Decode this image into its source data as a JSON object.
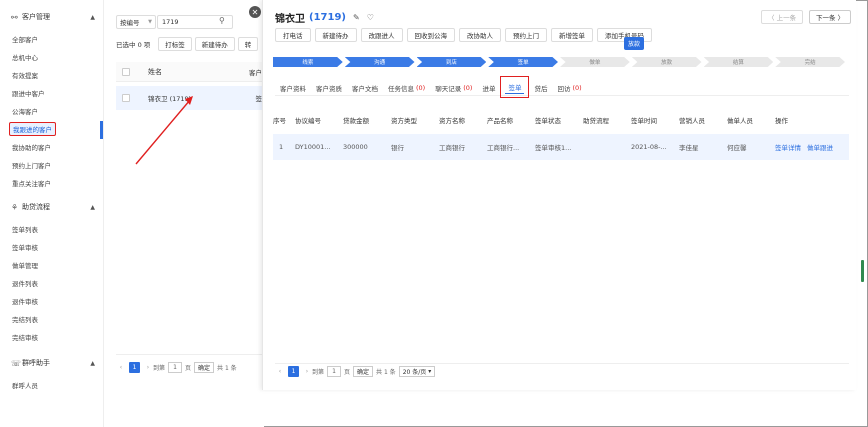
{
  "sidebar": {
    "groups": [
      {
        "label": "客户管理",
        "icon": "user-icon",
        "items": [
          "全部客户",
          "总机中心",
          "有效提案",
          "跟进中客户",
          "公海客户",
          "我跟进的客户",
          "我协助的客户",
          "预约上门客户",
          "重点关注客户"
        ]
      },
      {
        "label": "助贷流程",
        "icon": "flow-icon",
        "items": [
          "签单列表",
          "签单审核",
          "做单管理",
          "退件列表",
          "退件审核",
          "完结列表",
          "完结审核"
        ]
      },
      {
        "label": "群呼助手",
        "icon": "phone-icon",
        "items": [
          "群呼人员"
        ]
      }
    ],
    "active_item": "我跟进的客户"
  },
  "list_panel": {
    "search_type": "按编号",
    "search_value": "1719",
    "selected_count": "已选中 0 项",
    "toolbar_buttons": [
      "打标签",
      "新建待办",
      "转"
    ],
    "column_name": "姓名",
    "column_customer": "客户",
    "rows": [
      {
        "name": "锦衣卫 (1719)",
        "col2": "签"
      }
    ],
    "pagination": {
      "page": "1",
      "goto_label": "到第",
      "goto_value": "1",
      "page_unit": "页",
      "confirm": "确定",
      "total": "共 1 条"
    }
  },
  "detail": {
    "title": "锦衣卫",
    "id": "(1719)",
    "prev_label": "〈 上一条",
    "next_label": "下一条 〉",
    "actions": [
      "打电话",
      "新建待办",
      "改跟进人",
      "回收到公海",
      "改协助人",
      "预约上门",
      "新增签单",
      "添加手机号码"
    ],
    "tooltip": "放款",
    "steps": [
      {
        "label": "线索",
        "done": true
      },
      {
        "label": "沟通",
        "done": true
      },
      {
        "label": "到店",
        "done": true
      },
      {
        "label": "签单",
        "done": true
      },
      {
        "label": "做单",
        "done": false
      },
      {
        "label": "放款",
        "done": false
      },
      {
        "label": "结算",
        "done": false
      },
      {
        "label": "完结",
        "done": false
      }
    ],
    "tabs": [
      {
        "label": "客户资料",
        "count": ""
      },
      {
        "label": "客户资质",
        "count": ""
      },
      {
        "label": "客户文档",
        "count": ""
      },
      {
        "label": "任务信息",
        "count": "(0)"
      },
      {
        "label": "聊天记录",
        "count": "(0)"
      },
      {
        "label": "进单",
        "count": ""
      },
      {
        "label": "签单",
        "count": ""
      },
      {
        "label": "贷后",
        "count": ""
      },
      {
        "label": "回访",
        "count": "(0)"
      }
    ],
    "active_tab": "签单",
    "table": {
      "headers": [
        "序号",
        "协议编号",
        "贷款金额",
        "资方类型",
        "资方名称",
        "产品名称",
        "签单状态",
        "助贷流程",
        "签单时间",
        "营销人员",
        "做单人员",
        "操作"
      ],
      "rows": [
        {
          "cells": [
            "1",
            "DY10001...",
            "300000",
            "银行",
            "工商银行",
            "工商银行...",
            "签单审核1...",
            "",
            "2021-08-...",
            "李佳星",
            "何应馨"
          ],
          "ops": [
            "签单详情",
            "做单跟进"
          ]
        }
      ]
    },
    "pagination": {
      "page": "1",
      "goto_label": "到第",
      "goto_value": "1",
      "page_unit": "页",
      "confirm": "确定",
      "total": "共 1 条",
      "page_size": "20 条/页"
    }
  },
  "colors": {
    "primary": "#2c6fe0",
    "highlight_border": "#e02020",
    "row_highlight": "#eef4ff"
  }
}
